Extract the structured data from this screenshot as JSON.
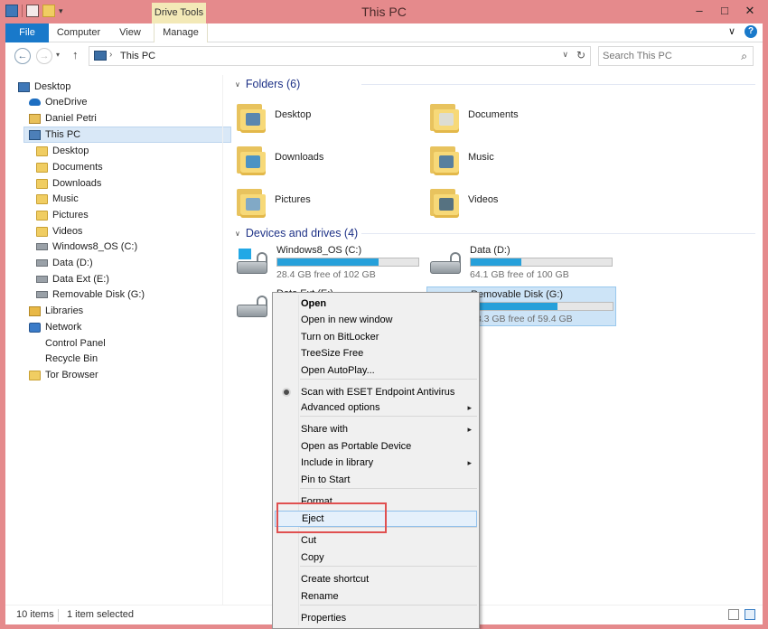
{
  "window": {
    "title": "This PC",
    "contextual_tab_group": "Drive Tools",
    "controls": {
      "minimize": "–",
      "maximize": "□",
      "close": "✕"
    }
  },
  "ribbon": {
    "tabs": [
      {
        "label": "File"
      },
      {
        "label": "Computer"
      },
      {
        "label": "View"
      },
      {
        "label": "Manage"
      }
    ],
    "collapse_glyph": "∨",
    "help_glyph": "?"
  },
  "navigation": {
    "back_glyph": "←",
    "forward_glyph": "→",
    "recent_glyph": "▾",
    "up_glyph": "↑",
    "address_separator": "›",
    "address_path": "This PC",
    "address_dropdown_glyph": "∨",
    "refresh_glyph": "↻",
    "search_placeholder": "Search This PC",
    "search_glyph": "⌕"
  },
  "tree": [
    {
      "label": "Desktop",
      "icon": "desktop"
    },
    {
      "label": "OneDrive",
      "icon": "onedrive"
    },
    {
      "label": "Daniel Petri",
      "icon": "user"
    },
    {
      "label": "This PC",
      "icon": "pc",
      "selected": true
    },
    {
      "label": "Desktop",
      "icon": "folder"
    },
    {
      "label": "Documents",
      "icon": "folder"
    },
    {
      "label": "Downloads",
      "icon": "folder"
    },
    {
      "label": "Music",
      "icon": "folder"
    },
    {
      "label": "Pictures",
      "icon": "folder"
    },
    {
      "label": "Videos",
      "icon": "folder"
    },
    {
      "label": "Windows8_OS (C:)",
      "icon": "drive"
    },
    {
      "label": "Data (D:)",
      "icon": "drive"
    },
    {
      "label": "Data Ext (E:)",
      "icon": "drive"
    },
    {
      "label": "Removable Disk (G:)",
      "icon": "drive"
    },
    {
      "label": "Libraries",
      "icon": "libraries"
    },
    {
      "label": "Network",
      "icon": "network"
    },
    {
      "label": "Control Panel",
      "icon": "control-panel"
    },
    {
      "label": "Recycle Bin",
      "icon": "recycle-bin"
    },
    {
      "label": "Tor Browser",
      "icon": "folder"
    }
  ],
  "folders_section": {
    "header": "Folders (6)",
    "chevron": "∨",
    "items": [
      {
        "label": "Desktop",
        "overlay_color": "#3f78b8"
      },
      {
        "label": "Documents",
        "overlay_color": "#d8dde3"
      },
      {
        "label": "Downloads",
        "overlay_color": "#2e86d1"
      },
      {
        "label": "Music",
        "overlay_color": "#3b6ea5"
      },
      {
        "label": "Pictures",
        "overlay_color": "#6ca0d4"
      },
      {
        "label": "Videos",
        "overlay_color": "#3a5f83"
      }
    ]
  },
  "drives_section": {
    "header": "Devices and drives (4)",
    "chevron": "∨",
    "drives": [
      {
        "name": "Windows8_OS (C:)",
        "free_text": "28.4 GB free of 102 GB",
        "used_fraction": 0.72,
        "is_system": true
      },
      {
        "name": "Data (D:)",
        "free_text": "64.1 GB free of 100 GB",
        "used_fraction": 0.36
      },
      {
        "name": "Data Ext (E:)",
        "free_text": "",
        "used_fraction": 0.0
      },
      {
        "name": "Removable Disk (G:)",
        "free_text": "23.3 GB free of 59.4 GB",
        "used_fraction": 0.61,
        "selected": true
      }
    ]
  },
  "context_menu": {
    "items": [
      {
        "label": "Open",
        "bold": true
      },
      {
        "label": "Open in new window"
      },
      {
        "label": "Turn on BitLocker"
      },
      {
        "label": "TreeSize Free"
      },
      {
        "label": "Open AutoPlay..."
      },
      {
        "label": "Scan with ESET Endpoint Antivirus",
        "icon": "eset"
      },
      {
        "label": "Advanced options",
        "submenu": true
      },
      {
        "label": "Share with",
        "submenu": true
      },
      {
        "label": "Open as Portable Device"
      },
      {
        "label": "Include in library",
        "submenu": true
      },
      {
        "label": "Pin to Start"
      },
      {
        "label": "Format..."
      },
      {
        "label": "Eject",
        "highlighted": true
      },
      {
        "label": "Cut"
      },
      {
        "label": "Copy"
      },
      {
        "label": "Create shortcut"
      },
      {
        "label": "Rename"
      },
      {
        "label": "Properties"
      }
    ],
    "submenu_glyph": "▸",
    "highlight_color": "#e05050"
  },
  "status": {
    "item_count": "10 items",
    "selection": "1 item selected"
  }
}
